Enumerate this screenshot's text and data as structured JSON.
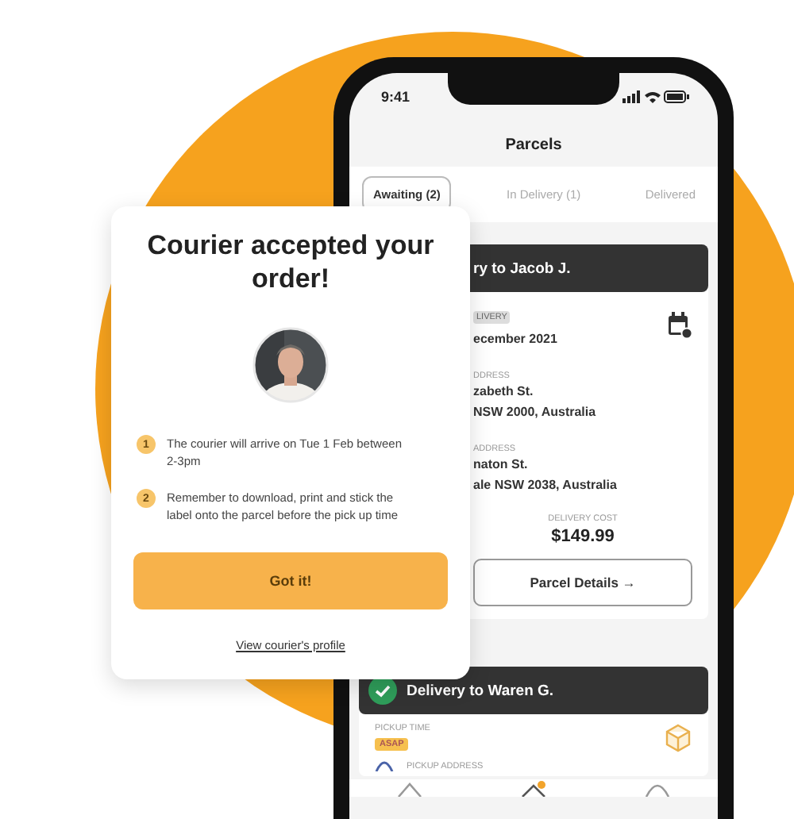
{
  "status_bar": {
    "time": "9:41"
  },
  "header": {
    "title": "Parcels"
  },
  "tabs": [
    {
      "label": "Awaiting (2)",
      "selected": true
    },
    {
      "label": "In Delivery (1)",
      "selected": false
    },
    {
      "label": "Delivered",
      "selected": false
    }
  ],
  "parcels": [
    {
      "kind": "details",
      "header": "ry to Jacob J.",
      "date_label": "LIVERY",
      "date": "ecember 2021",
      "from_label": "DDRESS",
      "from_lines": [
        "zabeth St.",
        "NSW 2000, Australia"
      ],
      "to_label": "ADDRESS",
      "to_lines": [
        "naton St.",
        "ale NSW 2038, Australia"
      ],
      "cost_label": "DELIVERY COST",
      "cost": "$149.99",
      "button": "Parcel Details →"
    },
    {
      "kind": "pickup",
      "header": "Delivery to Waren G.",
      "time_label": "PICKUP TIME",
      "tag": "ASAP",
      "address_label": "PICKUP ADDRESS"
    }
  ],
  "popup": {
    "title": "Courier accepted your order!",
    "steps": [
      {
        "number": "1",
        "text": "The courier will arrive on Tue 1 Feb between 2-3pm"
      },
      {
        "number": "2",
        "text": "Remember to download, print and stick the label onto the parcel before the pick up time"
      }
    ],
    "button": "Got it!",
    "link": "View courier's profile"
  }
}
